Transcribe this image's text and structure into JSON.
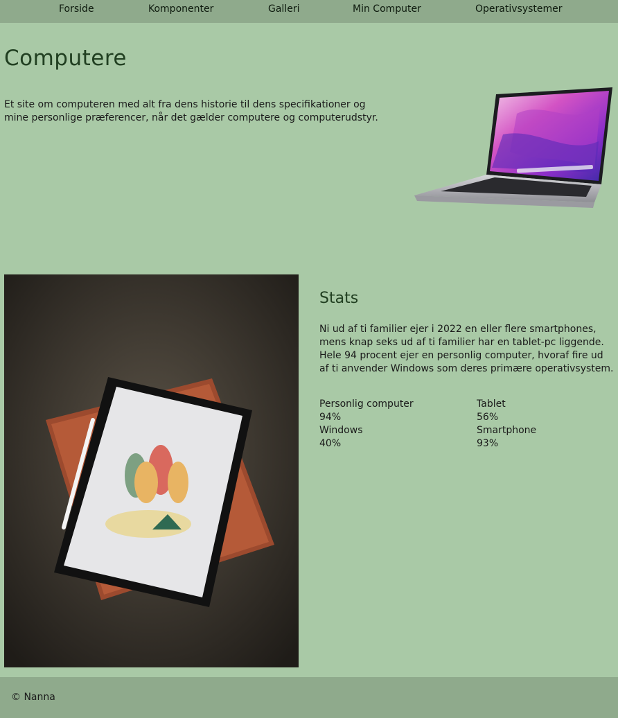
{
  "nav": {
    "items": [
      "Forside",
      "Komponenter",
      "Galleri",
      "Min Computer",
      "Operativsystemer"
    ]
  },
  "hero": {
    "title": "Computere",
    "intro": "Et site om computeren med alt fra dens historie til dens specifikationer og mine personlige præferencer, når det gælder computere og computerudstyr.",
    "image": "laptop-photo"
  },
  "gallery_image": "tablet-photo",
  "stats": {
    "title": "Stats",
    "text": "Ni ud af ti familier ejer i 2022 en eller flere smartphones, mens knap seks ud af ti familier har en tablet-pc liggende. Hele 94 procent ejer en personlig computer, hvoraf fire ud af ti anvender Windows som deres primære operativsystem.",
    "items": [
      {
        "label": "Personlig computer",
        "value": "94%"
      },
      {
        "label": "Tablet",
        "value": "56%"
      },
      {
        "label": "Windows",
        "value": "40%"
      },
      {
        "label": "Smartphone",
        "value": "93%"
      }
    ]
  },
  "footer": {
    "text": "© Nanna"
  },
  "colors": {
    "background": "#a9c9a6",
    "bars": "#8faa8c",
    "heading": "#213f21"
  }
}
